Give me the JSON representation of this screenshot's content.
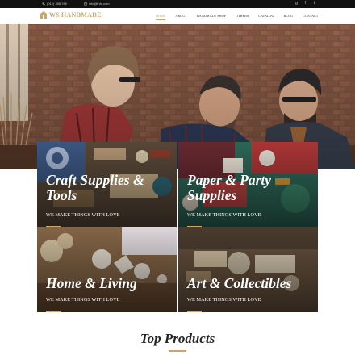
{
  "topbar": {
    "phone": "(012) 456 789",
    "email": "info@info.com",
    "social_icons": [
      "google-plus-icon",
      "facebook-icon",
      "twitter-icon"
    ]
  },
  "header": {
    "logo_text": "WS HANDMADE",
    "nav": [
      {
        "label": "HOME",
        "active": true
      },
      {
        "label": "ABOUT",
        "active": false
      },
      {
        "label": "HANDMADE SHOP",
        "active": false
      },
      {
        "label": "OTHERS",
        "active": false
      },
      {
        "label": "CATALOG",
        "active": false
      },
      {
        "label": "BLOG",
        "active": false
      },
      {
        "label": "CONTACT",
        "active": false
      }
    ]
  },
  "categories": [
    {
      "title_line1": "Craft Supplies &",
      "title_line2": "Tools",
      "subtitle": "WE MAKE THINGS WITH LOVE"
    },
    {
      "title_line1": "Paper & Party",
      "title_line2": "Supplies",
      "subtitle": "WE MAKE THINGS WITH LOVE"
    },
    {
      "title_line1": "Home & Living",
      "title_line2": "",
      "subtitle": "WE MAKE THINGS WITH LOVE"
    },
    {
      "title_line1": "Art & Collectibles",
      "title_line2": "",
      "subtitle": "WE MAKE THINGS WITH LOVE"
    }
  ],
  "section": {
    "title": "Top Products"
  },
  "colors": {
    "accent": "#c9a66b",
    "topbar": "#111111",
    "text": "#222222"
  }
}
